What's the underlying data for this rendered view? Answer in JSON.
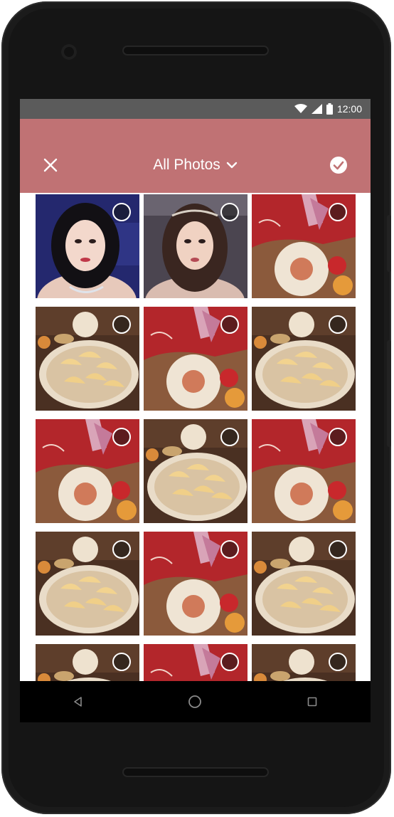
{
  "status_bar": {
    "time": "12:00",
    "icons": [
      "wifi-icon",
      "signal-icon",
      "battery-icon"
    ]
  },
  "app_bar": {
    "background": "#c07274",
    "title": "All Photos",
    "close_icon": "close-icon",
    "dropdown_icon": "chevron-down-icon",
    "confirm_icon": "check-circle-icon"
  },
  "photos": [
    {
      "kind": "portrait-a"
    },
    {
      "kind": "portrait-b"
    },
    {
      "kind": "mug"
    },
    {
      "kind": "pastry"
    },
    {
      "kind": "mug"
    },
    {
      "kind": "pastry"
    },
    {
      "kind": "mug"
    },
    {
      "kind": "pastry"
    },
    {
      "kind": "mug"
    },
    {
      "kind": "pastry"
    },
    {
      "kind": "mug"
    },
    {
      "kind": "pastry"
    },
    {
      "kind": "pastry"
    },
    {
      "kind": "mug"
    },
    {
      "kind": "pastry"
    }
  ],
  "nav_bar": {
    "icons": [
      "back-icon",
      "home-icon",
      "recents-icon"
    ]
  }
}
